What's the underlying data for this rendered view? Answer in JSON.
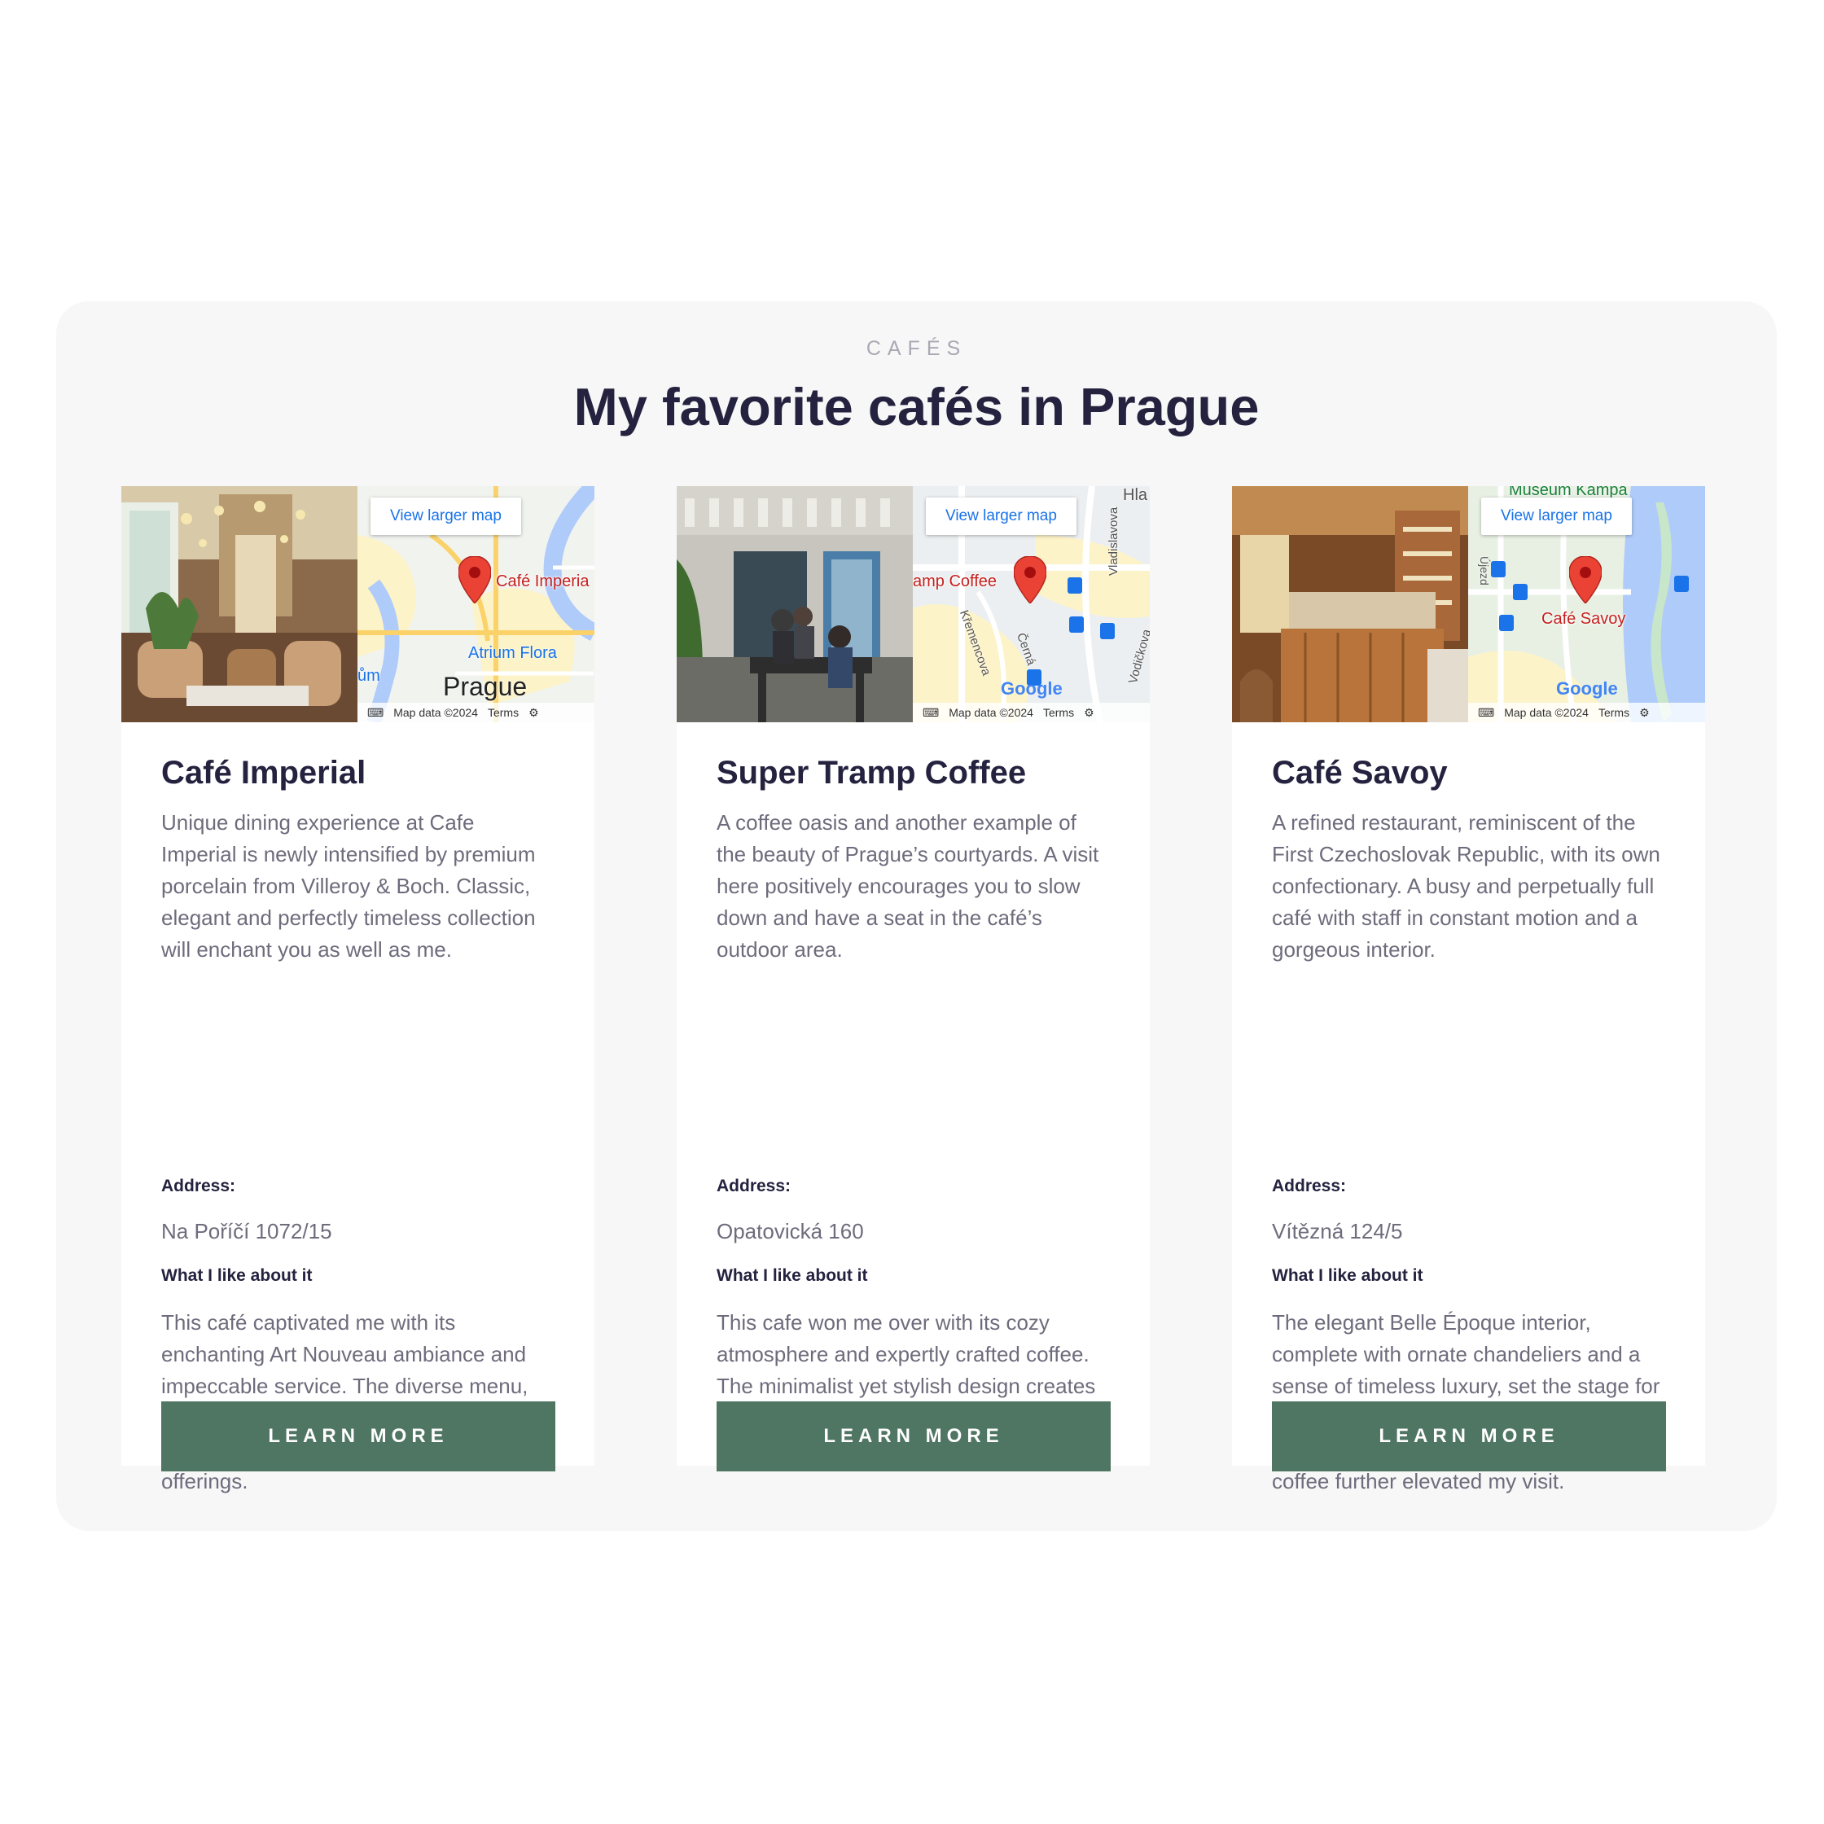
{
  "section": {
    "eyebrow": "CAFÉS",
    "title": "My favorite cafés in Prague"
  },
  "map_common": {
    "view_larger": "View larger map",
    "map_data": "Map data ©2024",
    "terms": "Terms",
    "google": "Google"
  },
  "cafes": [
    {
      "name": "Café Imperial",
      "description": "Unique dining experience at Cafe Imperial is newly intensified by premium porcelain from Villeroy & Boch. Classic, elegant and perfectly timeless collection will enchant you as well as me.",
      "address_label": "Address:",
      "address": "Na Poříčí 1072/15",
      "like_label": "What I like about it",
      "like_text": "This café captivated me with its enchanting Art Nouveau ambiance and impeccable service. The diverse menu, featuring both Czech and international dishes, impressed with its flavorful offerings.",
      "button": "LEARN MORE",
      "map_pin_label": "Café Imperia",
      "map_labels": [
        "Atrium Flora",
        "Prague",
        "ům"
      ]
    },
    {
      "name": "Super Tramp Coffee",
      "description": "A coffee oasis and another example of the beauty of Prague’s courtyards. A visit here positively encourages you to slow down and have a seat in the café’s outdoor area.",
      "address_label": "Address:",
      "address": "Opatovická 160",
      "like_label": "What I like about it",
      "like_text": "This cafe won me over with its cozy atmosphere and expertly crafted coffee. The minimalist yet stylish design creates a comfortable space to enjoy the rich, aromatic brews.",
      "button": "LEARN MORE",
      "map_pin_label": "amp Coffee",
      "map_labels": [
        "Hla",
        "Vladislavova",
        "Křemencova",
        "Černá",
        "Vodičkova"
      ]
    },
    {
      "name": "Café Savoy",
      "description": "A refined restaurant, reminiscent of the First Czechoslovak Republic, with its own confectionary. A busy and perpetually full café with staff in constant motion and a gorgeous interior.",
      "address_label": "Address:",
      "address": "Vítězná 124/5",
      "like_label": "What I like about it",
      "like_text": "The elegant Belle Époque interior, complete with ornate chandeliers and a sense of timeless luxury, set the stage for a delightful dining experience. The decadent pastries and expertly brewed coffee further elevated my visit.",
      "button": "LEARN MORE",
      "map_pin_label": "Café Savoy",
      "map_labels": [
        "Museum Kampa",
        "Újezd"
      ]
    }
  ]
}
